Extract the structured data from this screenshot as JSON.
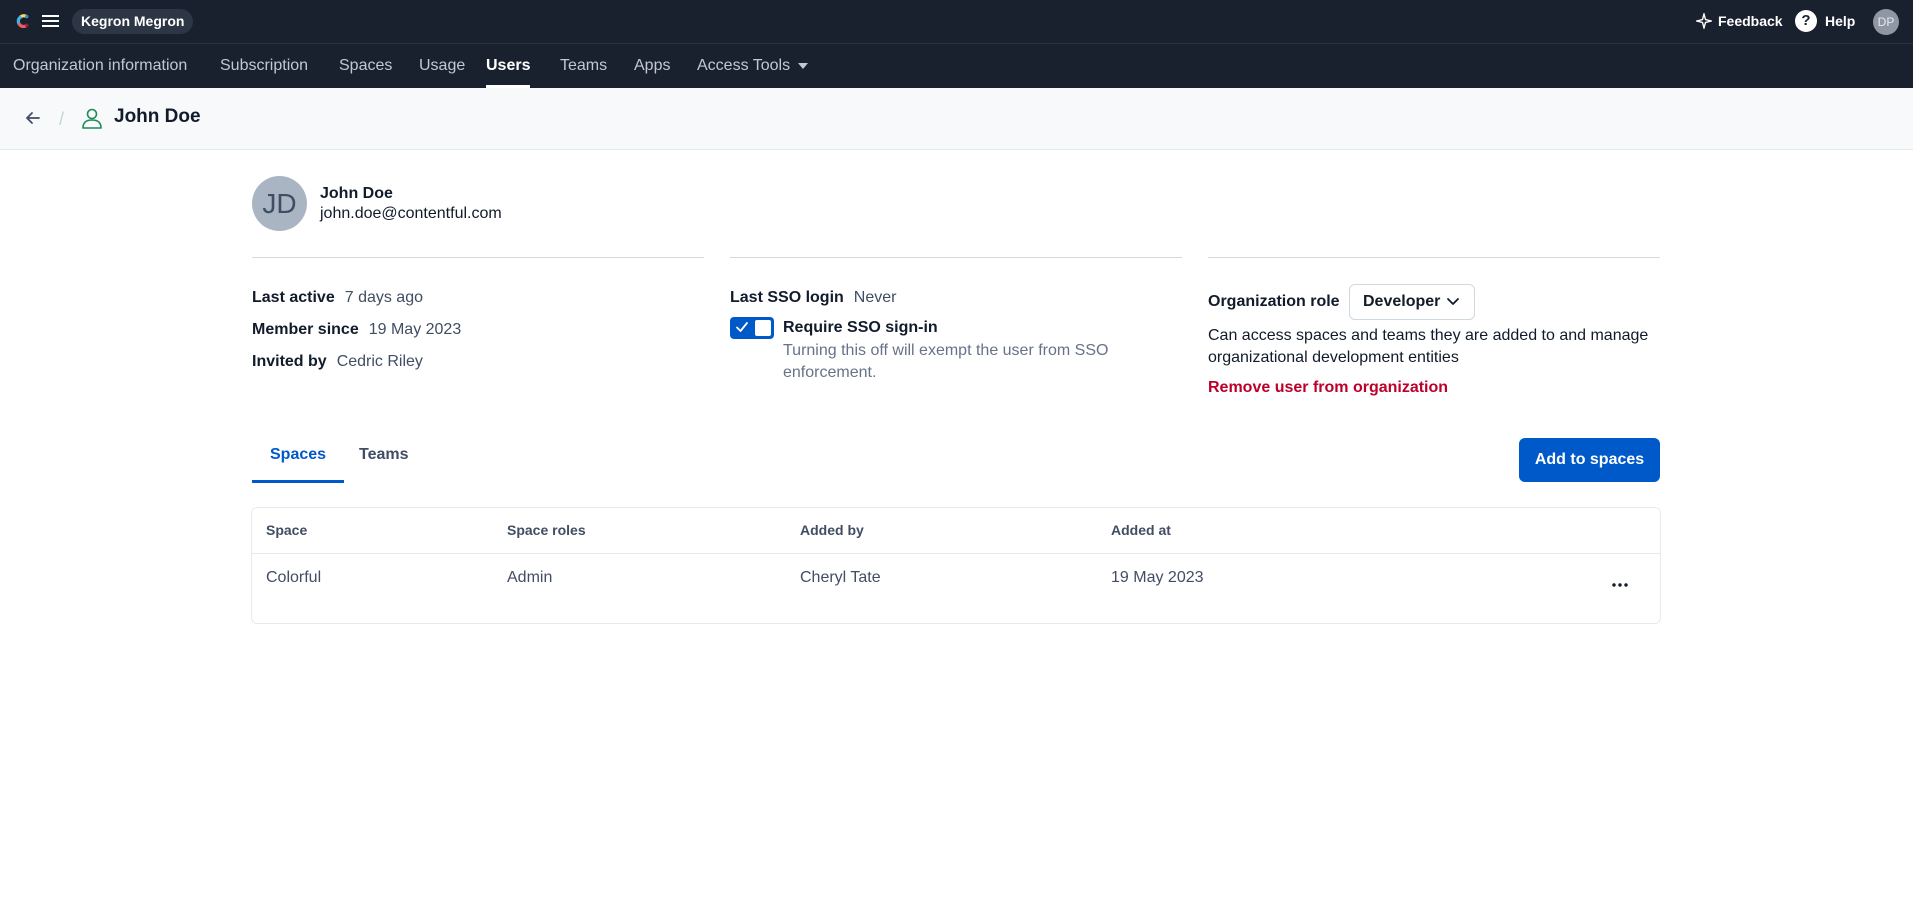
{
  "app": {
    "org_name": "Kegron Megron",
    "feedback_label": "Feedback",
    "help_label": "Help",
    "user_initials": "DP"
  },
  "nav": {
    "items": [
      {
        "label": "Organization information"
      },
      {
        "label": "Subscription"
      },
      {
        "label": "Spaces"
      },
      {
        "label": "Usage"
      },
      {
        "label": "Users",
        "active": true
      },
      {
        "label": "Teams"
      },
      {
        "label": "Apps"
      },
      {
        "label": "Access Tools",
        "has_dropdown": true
      }
    ]
  },
  "header": {
    "title": "John Doe"
  },
  "user": {
    "initials": "JD",
    "name": "John Doe",
    "email": "john.doe@contentful.com",
    "last_active_label": "Last active",
    "last_active": "7 days ago",
    "member_since_label": "Member since",
    "member_since": "19 May 2023",
    "invited_by_label": "Invited by",
    "invited_by": "Cedric Riley"
  },
  "sso": {
    "last_login_label": "Last SSO login",
    "last_login": "Never",
    "require_label": "Require SSO sign-in",
    "require_enabled": true,
    "help_text": "Turning this off will exempt the user from SSO enforcement."
  },
  "role": {
    "label": "Organization role",
    "selected": "Developer",
    "description": "Can access spaces and teams they are added to and manage organizational development entities",
    "remove_label": "Remove user from organization"
  },
  "tabs": [
    {
      "label": "Spaces",
      "active": true
    },
    {
      "label": "Teams"
    }
  ],
  "add_button_label": "Add to spaces",
  "table": {
    "columns": [
      "Space",
      "Space roles",
      "Added by",
      "Added at"
    ],
    "rows": [
      {
        "space": "Colorful",
        "roles": "Admin",
        "added_by": "Cheryl Tate",
        "added_at": "19 May 2023"
      }
    ],
    "row_menu_label": "..."
  },
  "colors": {
    "topbar_bg": "#19212e",
    "primary": "#0059c8",
    "danger": "#bd002a"
  },
  "icons": {
    "logo": "contentful-logo-icon",
    "menu": "hamburger-menu-icon",
    "feedback": "sparkle-icon",
    "help": "question-circle-icon",
    "back": "arrow-left-icon",
    "user": "user-icon",
    "chevron": "chevron-down-icon",
    "check": "check-icon",
    "more": "more-horizontal-icon"
  }
}
